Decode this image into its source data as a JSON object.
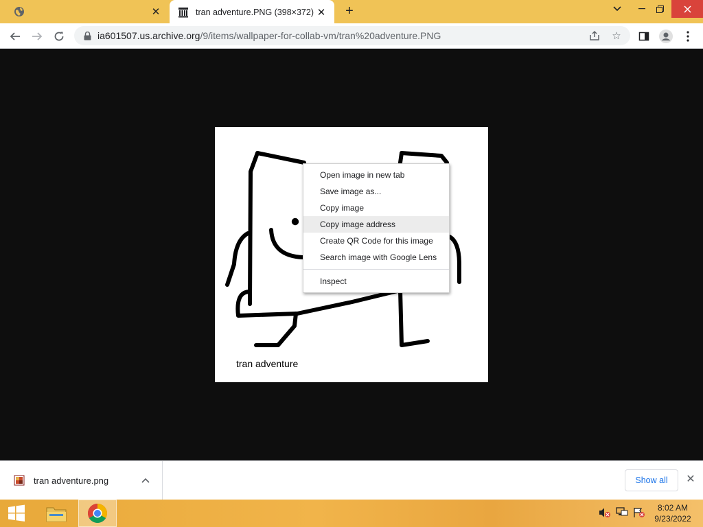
{
  "browser": {
    "tabs": [
      {
        "title": "",
        "favicon": "globe-icon",
        "active": false
      },
      {
        "title": "tran adventure.PNG (398×372)",
        "favicon": "archive-building-icon",
        "active": true
      }
    ],
    "new_tab_symbol": "+",
    "window_controls": {
      "minimize": "chevron-down",
      "restore": "restore",
      "close": "close"
    },
    "url": {
      "host": "ia601507.us.archive.org",
      "path": "/9/items/wallpaper-for-collab-vm/tran%20adventure.PNG"
    }
  },
  "page": {
    "image_caption": "tran adventure"
  },
  "context_menu": {
    "items": [
      {
        "label": "Open image in new tab",
        "highlighted": false
      },
      {
        "label": "Save image as...",
        "highlighted": false
      },
      {
        "label": "Copy image",
        "highlighted": false
      },
      {
        "label": "Copy image address",
        "highlighted": true
      },
      {
        "label": "Create QR Code for this image",
        "highlighted": false
      },
      {
        "label": "Search image with Google Lens",
        "highlighted": false
      }
    ],
    "footer_item": "Inspect"
  },
  "downloads": {
    "file_name": "tran adventure.png",
    "show_all_label": "Show all"
  },
  "taskbar": {
    "time": "8:02 AM",
    "date": "9/23/2022"
  },
  "colors": {
    "tabstrip": "#f0c356",
    "page_background": "#0e0e0e",
    "accent_link": "#1a73e8",
    "close_button": "#d9433b"
  }
}
